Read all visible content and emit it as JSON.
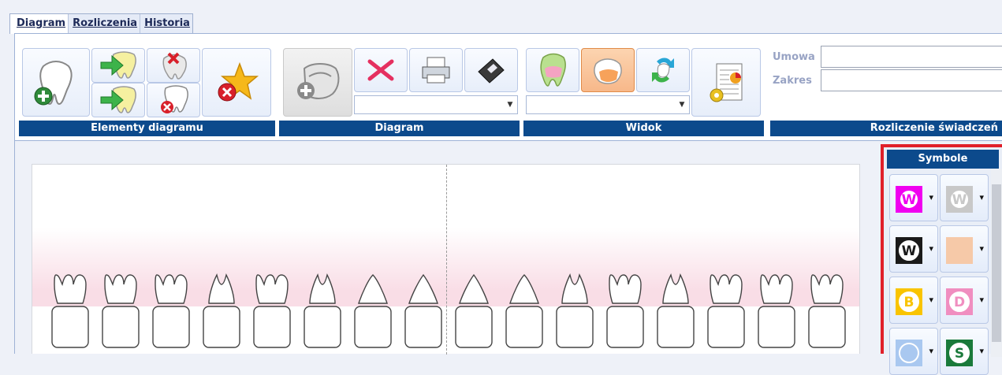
{
  "tabs": [
    {
      "label": "Diagram",
      "active": true
    },
    {
      "label": "Rozliczenia",
      "active": false
    },
    {
      "label": "Historia",
      "active": false
    }
  ],
  "ribbon": {
    "groups": {
      "elements": "Elementy diagramu",
      "diagram": "Diagram",
      "view": "Widok",
      "billing": "Rozliczenie świadczeń"
    },
    "diagram_combo_value": "",
    "view_combo_value": "",
    "umowa_label": "Umowa",
    "umowa_value": "",
    "zakres_label": "Zakres",
    "zakres_value": ""
  },
  "icons": {
    "add_tooth": "tooth-add-icon",
    "move_in": "tooth-move-in-icon",
    "remove_element": "tooth-remove-icon",
    "move_out": "tooth-move-out-icon",
    "tooth_delete": "tooth-delete-icon",
    "clear_star": "star-clear-icon",
    "jaw_add": "jaw-add-icon",
    "delete_x": "delete-x-icon",
    "print": "printer-icon",
    "save": "floppy-disk-icon",
    "tooth_color": "tooth-color-icon",
    "tooth_crown": "tooth-crown-icon",
    "refresh": "refresh-arrows-icon",
    "report": "report-settings-icon"
  },
  "symbols_panel": {
    "title": "Symbole",
    "items": [
      {
        "letter": "W",
        "bg": "#f000f0",
        "fg": "#ffffff",
        "ring": "#f000f0"
      },
      {
        "letter": "W",
        "bg": "#c8c8c8",
        "fg": "#ffffff",
        "ring": "#c8c8c8"
      },
      {
        "letter": "W",
        "bg": "#1a1a1a",
        "fg": "#1a1a1a",
        "ring": "#ffffff"
      },
      {
        "letter": "",
        "bg": "#f6c9a8",
        "fg": "#f6c9a8",
        "ring": "#f6c9a8"
      },
      {
        "letter": "B",
        "bg": "#f9c400",
        "fg": "#f9c400",
        "ring": "#ffffff"
      },
      {
        "letter": "D",
        "bg": "#f08ec0",
        "fg": "#f08ec0",
        "ring": "#ffffff"
      },
      {
        "letter": "",
        "bg": "#a9c8f0",
        "fg": "#a9c8f0",
        "ring": "#ffffff"
      },
      {
        "letter": "S",
        "bg": "#1a7a3a",
        "fg": "#1a7a3a",
        "ring": "#ffffff"
      }
    ]
  },
  "teeth": {
    "upper_types": [
      "molar",
      "molar",
      "molar",
      "premolar",
      "molar",
      "premolar",
      "canine",
      "incisor",
      "incisor",
      "canine",
      "premolar",
      "molar",
      "premolar",
      "molar",
      "molar",
      "molar"
    ]
  },
  "colors": {
    "accent_blue": "#0c4a8c",
    "panel_border": "#e0202a",
    "tab_text": "#1d2a58",
    "field_label": "#98a3c4"
  }
}
